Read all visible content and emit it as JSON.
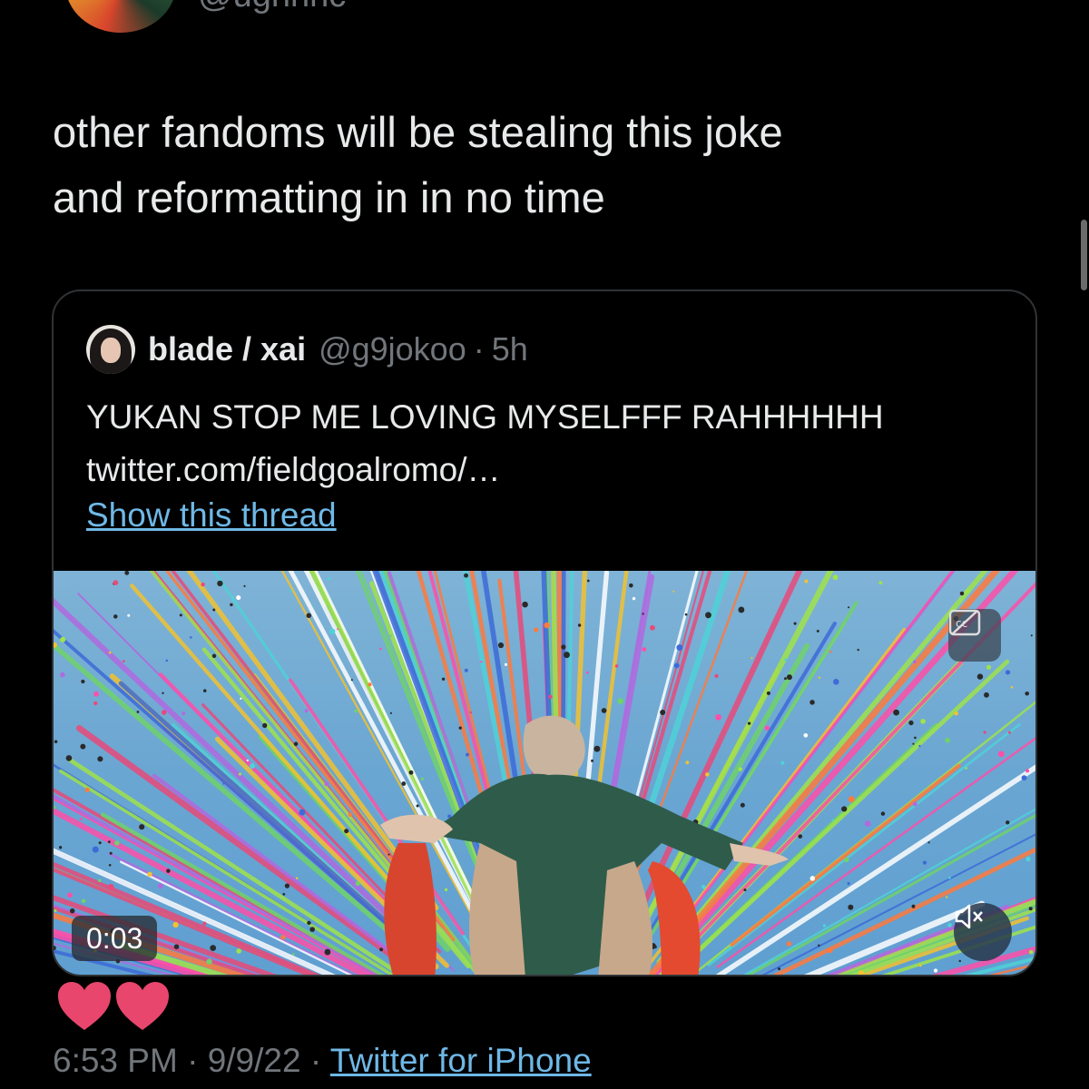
{
  "author": {
    "handle": "@ughnnc"
  },
  "tweet": {
    "text": "other fandoms will be stealing this joke\nand reformatting in in no time"
  },
  "quote": {
    "name": "blade / xai",
    "handle": "@g9jokoo",
    "separator": "·",
    "time": "5h",
    "text": "YUKAN STOP ME LOVING MYSELFFF RAHHHHHH\ntwitter.com/fieldgoalromo/…",
    "show_thread": "Show this thread",
    "video": {
      "timer": "0:03",
      "cc_icon": "cc-icon",
      "mute_icon": "speaker-muted-icon"
    }
  },
  "reactions": {
    "icons": [
      "heart-icon",
      "heart-icon"
    ],
    "color": "#e8466c"
  },
  "meta": {
    "time": "6:53 PM",
    "sep1": "·",
    "date": "9/9/22",
    "sep2": "·",
    "source": "Twitter for iPhone"
  },
  "colors": {
    "link": "#6fb8e6",
    "muted": "#71767b",
    "text": "#e7e9ea"
  }
}
